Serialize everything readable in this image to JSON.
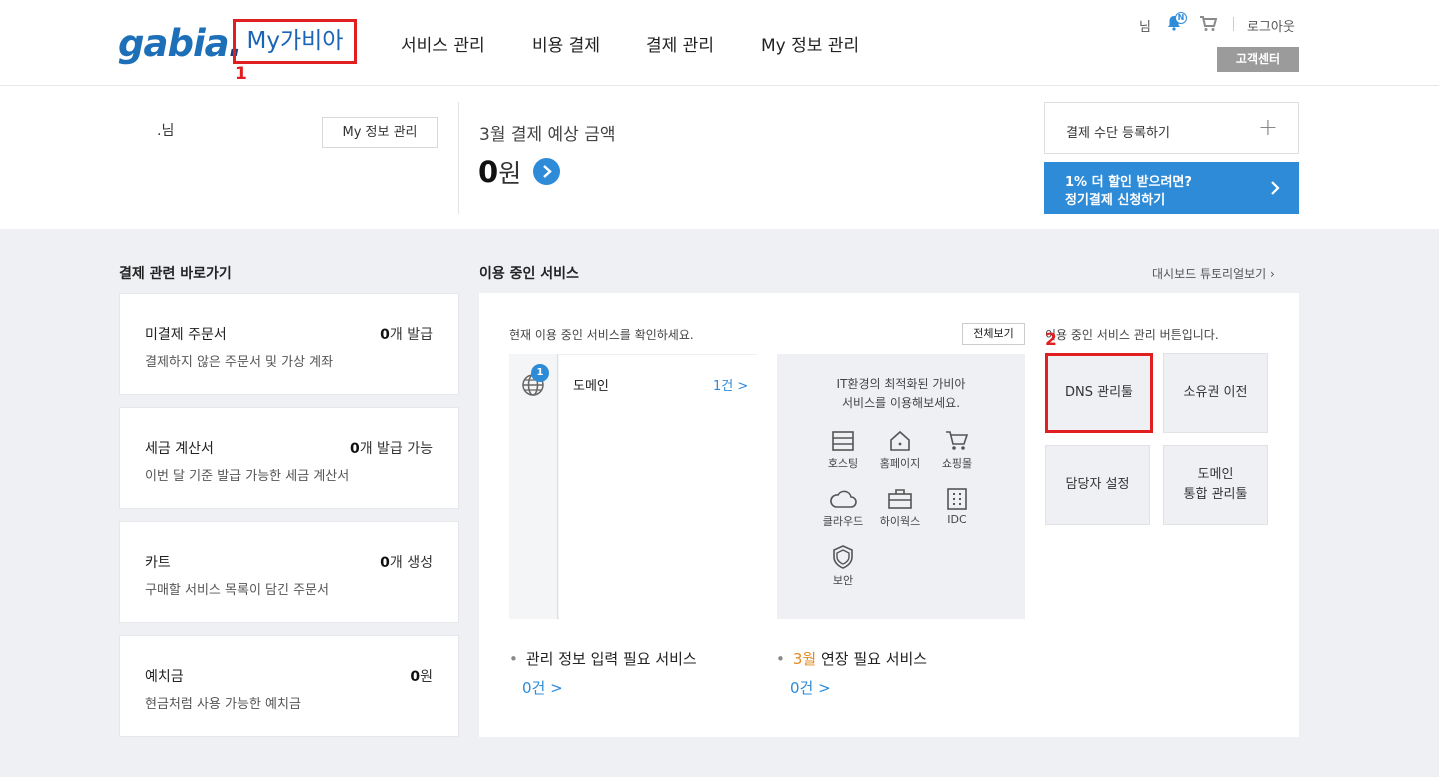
{
  "header": {
    "logo": "gabia",
    "logo_dot": ".",
    "my_gabia": "My가비아",
    "callout_1": "1",
    "nav": [
      "서비스 관리",
      "비용 결제",
      "결제 관리",
      "My 정보 관리"
    ],
    "user_suffix": "님",
    "notif_badge": "N",
    "logout": "로그아웃",
    "customer_center": "고객센터"
  },
  "summary": {
    "user_name": ".님",
    "my_info_button": "My 정보 관리",
    "estimate_label": "3월 결제 예상 금액",
    "estimate_amount": "0",
    "estimate_unit": "원",
    "register_payment": "결제 수단 등록하기",
    "discount_line1": "1% 더 할인 받으려면?",
    "discount_line2": "정기결제 신청하기"
  },
  "shortcuts": {
    "title": "결제 관련 바로가기",
    "cards": [
      {
        "title": "미결제 주문서",
        "count": "0",
        "unit": "개 발급",
        "desc": "결제하지 않은 주문서 및 가상 계좌"
      },
      {
        "title": "세금 계산서",
        "count": "0",
        "unit": "개 발급 가능",
        "desc": "이번 달 기준 발급 가능한 세금 계산서"
      },
      {
        "title": "카트",
        "count": "0",
        "unit": "개 생성",
        "desc": "구매할 서비스 목록이 담긴 주문서"
      },
      {
        "title": "예치금",
        "count": "0",
        "unit": "원",
        "desc": "현금처럼 사용 가능한 예치금"
      }
    ]
  },
  "services": {
    "title": "이용 중인 서비스",
    "tutorial_link": "대시보드 튜토리얼보기",
    "check_text": "현재 이용 중인 서비스를 확인하세요.",
    "view_all": "전체보기",
    "domain_badge": "1",
    "domain_label": "도메인",
    "domain_count": "1건 >",
    "promo_line1": "IT환경의 최적화된 가비아",
    "promo_line2": "서비스를 이용해보세요.",
    "promo_items": [
      "호스팅",
      "홈페이지",
      "쇼핑몰",
      "클라우드",
      "하이웍스",
      "IDC",
      "보안"
    ],
    "manage_text": "이용 중인 서비스 관리 버튼입니다.",
    "callout_2": "2",
    "tiles": [
      "DNS 관리툴",
      "소유권 이전",
      "담당자 설정",
      "도메인",
      "통합 관리툴"
    ],
    "need_info_label": "관리 정보 입력 필요 서비스",
    "need_info_count": "0건 >",
    "renew_month": "3월",
    "renew_label": " 연장 필요 서비스",
    "renew_count": "0건 >"
  },
  "colors": {
    "accent": "#2e8bd8",
    "highlight": "#e02020",
    "brand": "#1d6fb8",
    "renew_month": "#e08a1e"
  }
}
